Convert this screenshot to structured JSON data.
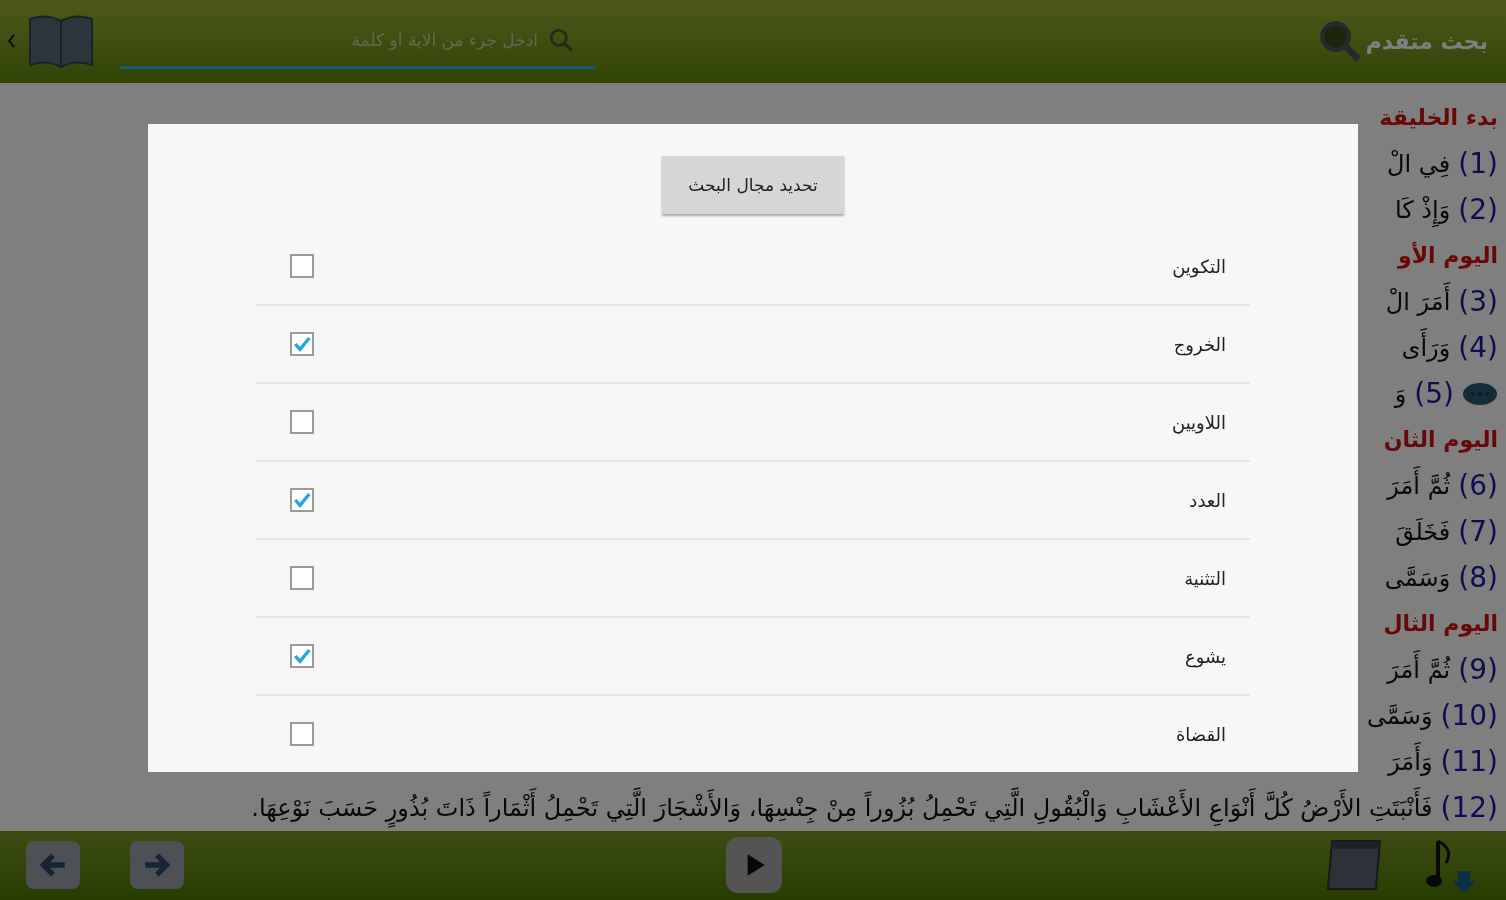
{
  "header": {
    "advanced_search": "بحث متقدم",
    "search": {
      "placeholder": "ادخل جزء من الاية او كلمة"
    }
  },
  "lines": [
    {
      "kind": "heading",
      "text": "بدء الخليقة"
    },
    {
      "kind": "verse",
      "number": "(1)",
      "text": "فِي الْ",
      "note": false
    },
    {
      "kind": "verse",
      "number": "(2)",
      "text": "وَإِذْ كَا",
      "note": false
    },
    {
      "kind": "heading",
      "text": "اليوم الأو"
    },
    {
      "kind": "verse",
      "number": "(3)",
      "text": "أَمَرَ الْ",
      "note": false
    },
    {
      "kind": "verse",
      "number": "(4)",
      "text": "وَرَأَى",
      "note": false
    },
    {
      "kind": "verse",
      "number": "(5)",
      "text": "وَ",
      "note": true
    },
    {
      "kind": "heading",
      "text": "اليوم الثان"
    },
    {
      "kind": "verse",
      "number": "(6)",
      "text": "ثُمَّ أَمَرَ",
      "note": false
    },
    {
      "kind": "verse",
      "number": "(7)",
      "text": "فَخَلَقَ",
      "note": false
    },
    {
      "kind": "verse",
      "number": "(8)",
      "text": "وَسَمَّى",
      "note": false
    },
    {
      "kind": "heading",
      "text": "اليوم الثال"
    },
    {
      "kind": "verse",
      "number": "(9)",
      "text": "ثُمَّ أَمَرَ",
      "note": false
    },
    {
      "kind": "verse",
      "number": "(10)",
      "text": "وَسَمَّى",
      "note": false
    },
    {
      "kind": "verse",
      "number": "(11)",
      "text": "وَأَمَرَ",
      "note": false
    },
    {
      "kind": "verse",
      "number": "(12)",
      "text": "فَأَنْبَتَتِ الأَرْضُ كُلَّ أَنْوَاعِ الأَعْشَابِ وَالْبُقُولِ الَّتِي تَحْمِلُ بُزُوراً مِنْ جِنْسِهَا، وَالأَشْجَارَ الَّتِي تَحْمِلُ أَثْمَاراً ذَاتَ بُذُورٍ حَسَبَ نَوْعِهَا.",
      "note": false
    }
  ],
  "dialog": {
    "button": "تحديد مجال البحث",
    "books": [
      {
        "label": "التكوين",
        "checked": false
      },
      {
        "label": "الخروج",
        "checked": true
      },
      {
        "label": "اللاويين",
        "checked": false
      },
      {
        "label": "العدد",
        "checked": true
      },
      {
        "label": "التثنية",
        "checked": false
      },
      {
        "label": "يشوع",
        "checked": true
      },
      {
        "label": "القضاة",
        "checked": false
      }
    ]
  }
}
